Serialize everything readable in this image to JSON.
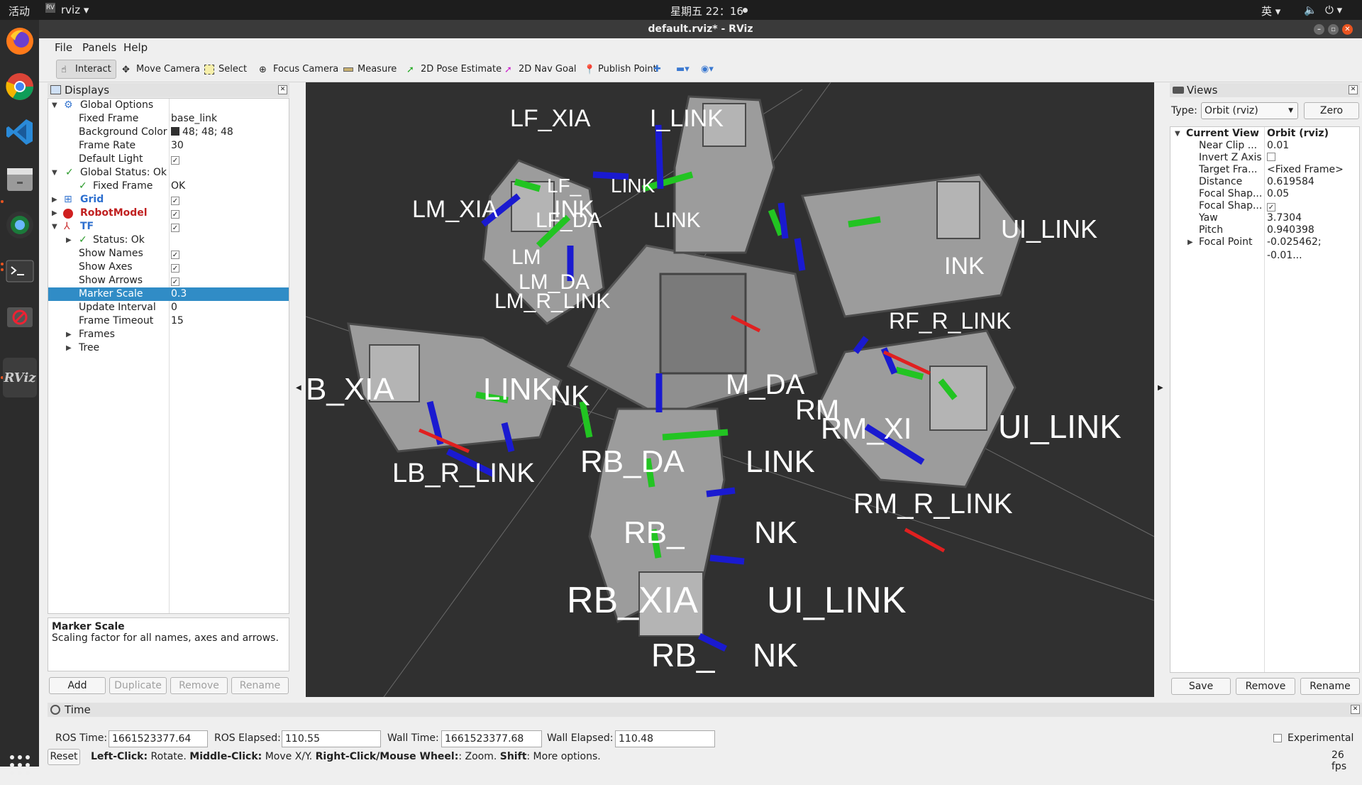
{
  "topbar": {
    "activities": "活动",
    "app_menu": "rviz ▾",
    "clock": "星期五 22：16",
    "input_method": "英 ▾"
  },
  "window": {
    "title": "default.rviz* - RViz"
  },
  "menu": {
    "file": "File",
    "panels": "Panels",
    "help": "Help"
  },
  "toolbar": {
    "interact": "Interact",
    "move_camera": "Move Camera",
    "select": "Select",
    "focus_camera": "Focus Camera",
    "measure": "Measure",
    "pose_estimate": "2D Pose Estimate",
    "nav_goal": "2D Nav Goal",
    "publish_point": "Publish Point"
  },
  "displays": {
    "title": "Displays",
    "rows": [
      {
        "label": "Global Options"
      },
      {
        "label": "Fixed Frame",
        "value": "base_link"
      },
      {
        "label": "Background Color",
        "value": "48; 48; 48"
      },
      {
        "label": "Frame Rate",
        "value": "30"
      },
      {
        "label": "Default Light"
      },
      {
        "label": "Global Status: Ok"
      },
      {
        "label": "Fixed Frame",
        "value": "OK"
      },
      {
        "label": "Grid"
      },
      {
        "label": "RobotModel"
      },
      {
        "label": "TF"
      },
      {
        "label": "Status: Ok"
      },
      {
        "label": "Show Names"
      },
      {
        "label": "Show Axes"
      },
      {
        "label": "Show Arrows"
      },
      {
        "label": "Marker Scale",
        "value": "0.3"
      },
      {
        "label": "Update Interval",
        "value": "0"
      },
      {
        "label": "Frame Timeout",
        "value": "15"
      },
      {
        "label": "Frames"
      },
      {
        "label": "Tree"
      }
    ],
    "desc_title": "Marker Scale",
    "desc_text": "Scaling factor for all names, axes and arrows.",
    "buttons": {
      "add": "Add",
      "duplicate": "Duplicate",
      "remove": "Remove",
      "rename": "Rename"
    }
  },
  "viewport_labels": [
    "LF_XIA",
    "I_LINK",
    "LM_XIA",
    "INK",
    "LF_",
    "LINK",
    "LF_DA",
    "LINK",
    "LM",
    "LM_DA",
    "LM_R_LINK",
    "UI_LINK",
    "INK",
    "RF_R_LINK",
    "B_XIA",
    "LINK",
    "NK",
    "M_DA",
    "RM",
    "RM_XI",
    "UI_LINK",
    "LB_R_LINK",
    "RB_DA",
    "LINK",
    "RM_R_LINK",
    "RB_",
    "NK",
    "RB_XIA",
    "UI_LINK",
    "RB_",
    "NK"
  ],
  "views": {
    "title": "Views",
    "type_label": "Type:",
    "type_value": "Orbit (rviz)",
    "zero": "Zero",
    "rows": [
      {
        "label": "Current View",
        "value": "Orbit (rviz)"
      },
      {
        "label": "Near Clip ...",
        "value": "0.01"
      },
      {
        "label": "Invert Z Axis",
        "value": ""
      },
      {
        "label": "Target Fra...",
        "value": "<Fixed Frame>"
      },
      {
        "label": "Distance",
        "value": "0.619584"
      },
      {
        "label": "Focal Shap...",
        "value": "0.05"
      },
      {
        "label": "Focal Shap...",
        "value": ""
      },
      {
        "label": "Yaw",
        "value": "3.7304"
      },
      {
        "label": "Pitch",
        "value": "0.940398"
      },
      {
        "label": "Focal Point",
        "value": "-0.025462; -0.01..."
      }
    ],
    "buttons": {
      "save": "Save",
      "remove": "Remove",
      "rename": "Rename"
    }
  },
  "time": {
    "title": "Time",
    "ros_time_label": "ROS Time:",
    "ros_time": "1661523377.64",
    "ros_elapsed_label": "ROS Elapsed:",
    "ros_elapsed": "110.55",
    "wall_time_label": "Wall Time:",
    "wall_time": "1661523377.68",
    "wall_elapsed_label": "Wall Elapsed:",
    "wall_elapsed": "110.48",
    "experimental": "Experimental"
  },
  "status": {
    "reset": "Reset",
    "left_click": "Left-Click:",
    "left_click_text": " Rotate. ",
    "middle_click": "Middle-Click:",
    "middle_click_text": " Move X/Y. ",
    "right_click": "Right-Click/Mouse Wheel:",
    "right_click_text": ": Zoom. ",
    "shift": "Shift",
    "shift_text": ": More options.",
    "fps": "26 fps"
  },
  "colors": {
    "background": "#303030",
    "selection": "#308cc6",
    "robot": "#9a9a9a"
  }
}
